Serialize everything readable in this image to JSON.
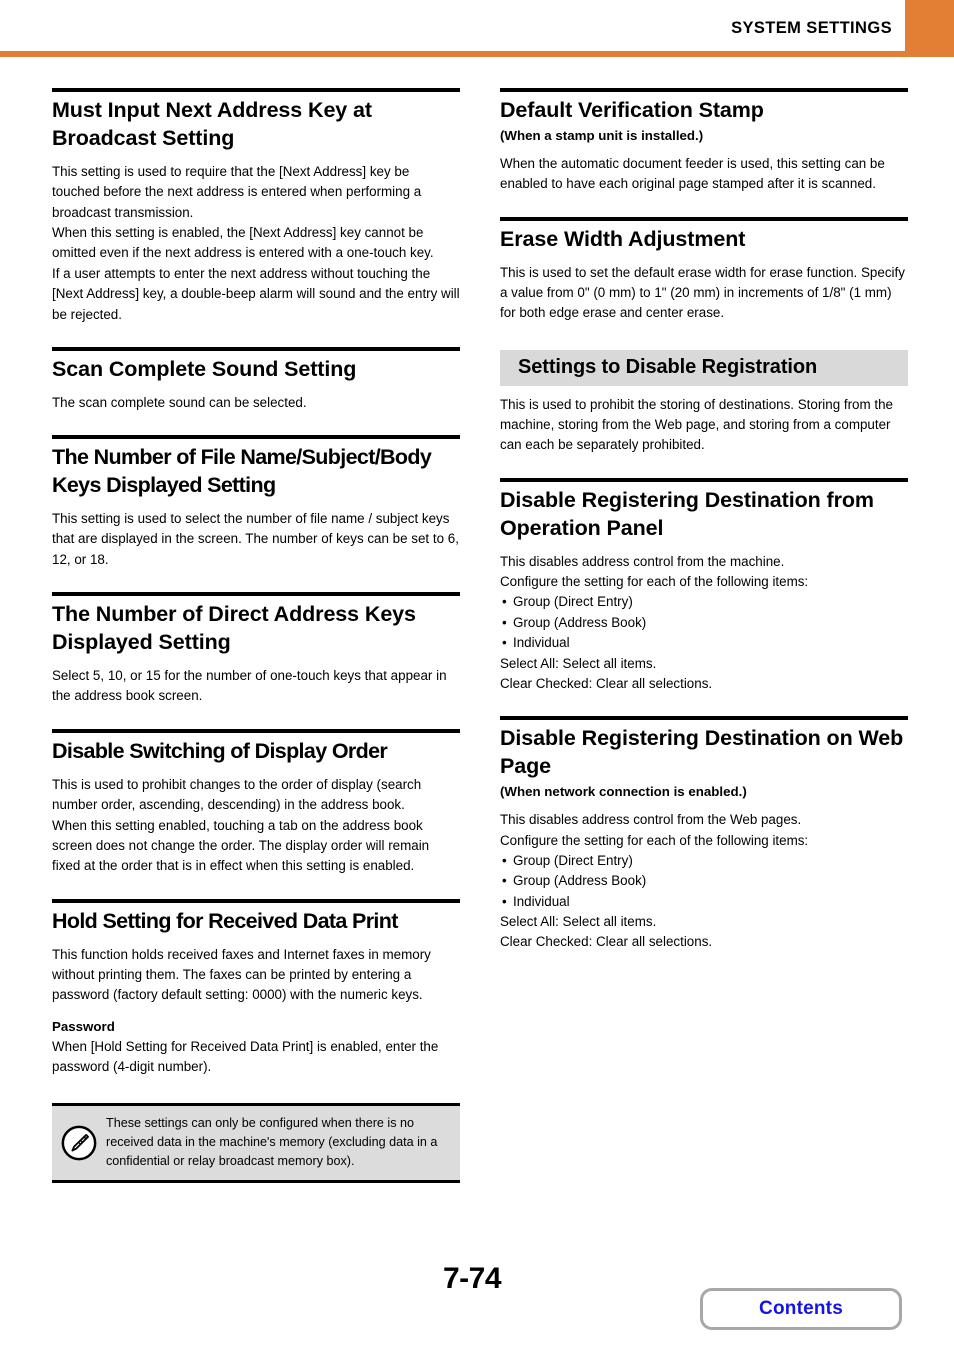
{
  "header": {
    "title": "SYSTEM SETTINGS",
    "accent_color": "#e27f34"
  },
  "left_column": {
    "sections": [
      {
        "heading": "Must Input Next Address Key at Broadcast Setting",
        "body": "This setting is used to require that the [Next Address] key be touched before the next address is entered when performing a broadcast transmission.\nWhen this setting is enabled, the [Next Address] key cannot be omitted even if the next address is entered with a one-touch key.\nIf a user attempts to enter the next address without touching the [Next Address] key, a double-beep alarm will sound and the entry will be rejected."
      },
      {
        "heading": "Scan Complete Sound Setting",
        "body": "The scan complete sound can be selected."
      },
      {
        "heading": "The Number of File Name/Subject/Body Keys Displayed Setting",
        "body": "This setting is used to select the number of file name / subject keys that are displayed in the screen. The number of keys can be set to 6, 12, or 18."
      },
      {
        "heading": "The Number of Direct Address Keys Displayed Setting",
        "body": "Select 5, 10, or 15 for the number of one-touch keys that appear in the address book screen."
      },
      {
        "heading": "Disable Switching of Display Order",
        "body": "This is used to prohibit changes to the order of display (search number order, ascending, descending) in the address book.\nWhen this setting enabled, touching a tab on the address book screen does not change the order. The display order will remain fixed at the order that is in effect when this setting is enabled."
      },
      {
        "heading": "Hold Setting for Received Data Print",
        "body": "This function holds received faxes and Internet faxes in memory without printing them. The faxes can be printed by entering a password (factory default setting: 0000) with the numeric keys.",
        "sub_label": "Password",
        "sub_body": "When [Hold Setting for Received Data Print] is enabled, enter the password (4-digit number)."
      }
    ],
    "note": {
      "icon": "pencil-note-icon",
      "text": "These settings can only be configured when there is no received data in the machine's memory (excluding data in a confidential or relay broadcast memory box)."
    }
  },
  "right_column": {
    "sections": [
      {
        "heading": "Default Verification Stamp",
        "subheading": "(When a stamp unit is installed.)",
        "body": "When the automatic document feeder is used, this setting can be enabled to have each original page stamped after it is scanned."
      },
      {
        "heading": "Erase Width Adjustment",
        "body": "This is used to set the default erase width for erase function. Specify a value from 0\" (0 mm) to 1\" (20 mm) in increments of 1/8\" (1 mm) for both edge erase and center erase."
      }
    ],
    "banner": {
      "title": "Settings to Disable Registration",
      "body": "This is used to prohibit the storing of destinations. Storing from the machine, storing from the Web page, and storing from a computer can each be separately prohibited."
    },
    "sections_after_banner": [
      {
        "heading": "Disable Registering Destination from Operation Panel",
        "body": "This disables address control from the machine.\nConfigure the setting for each of the following items:",
        "bullets": [
          "Group (Direct Entry)",
          "Group (Address Book)",
          "Individual"
        ],
        "footer_lines": [
          "Select All: Select all items.",
          "Clear Checked: Clear all selections."
        ]
      },
      {
        "heading": "Disable Registering Destination on Web Page",
        "subheading": "(When network connection is enabled.)",
        "body": "This disables address control from the Web pages.\nConfigure the setting for each of the following items:",
        "bullets": [
          "Group (Direct Entry)",
          "Group (Address Book)",
          "Individual"
        ],
        "footer_lines": [
          "Select All: Select all items.",
          "Clear Checked: Clear all selections."
        ]
      }
    ]
  },
  "footer": {
    "page_number": "7-74",
    "contents_label": "Contents",
    "contents_color": "#1414ea"
  }
}
